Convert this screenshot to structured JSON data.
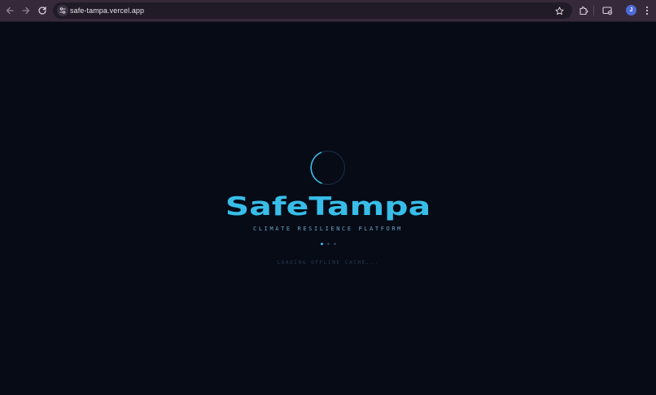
{
  "browser": {
    "url": "safe-tampa.vercel.app",
    "profile_initial": "J",
    "icons": {
      "back": "back-arrow-icon",
      "forward": "forward-arrow-icon",
      "reload": "reload-icon",
      "site_info": "tune-icon",
      "bookmark": "star-icon",
      "extensions": "puzzle-icon",
      "media": "cast-icon",
      "menu": "kebab-menu-icon"
    }
  },
  "page": {
    "brand_title": "SafeTampa",
    "tagline": "CLIMATE RESILIENCE PLATFORM",
    "loading_status": "LOADING OFFLINE CACHE...",
    "colors": {
      "background": "#060b16",
      "accent": "#38bde8",
      "spinner_track": "#1b2a3d",
      "dot_active": "#38bde8",
      "dot_inactive": "#2a3a4e"
    }
  }
}
